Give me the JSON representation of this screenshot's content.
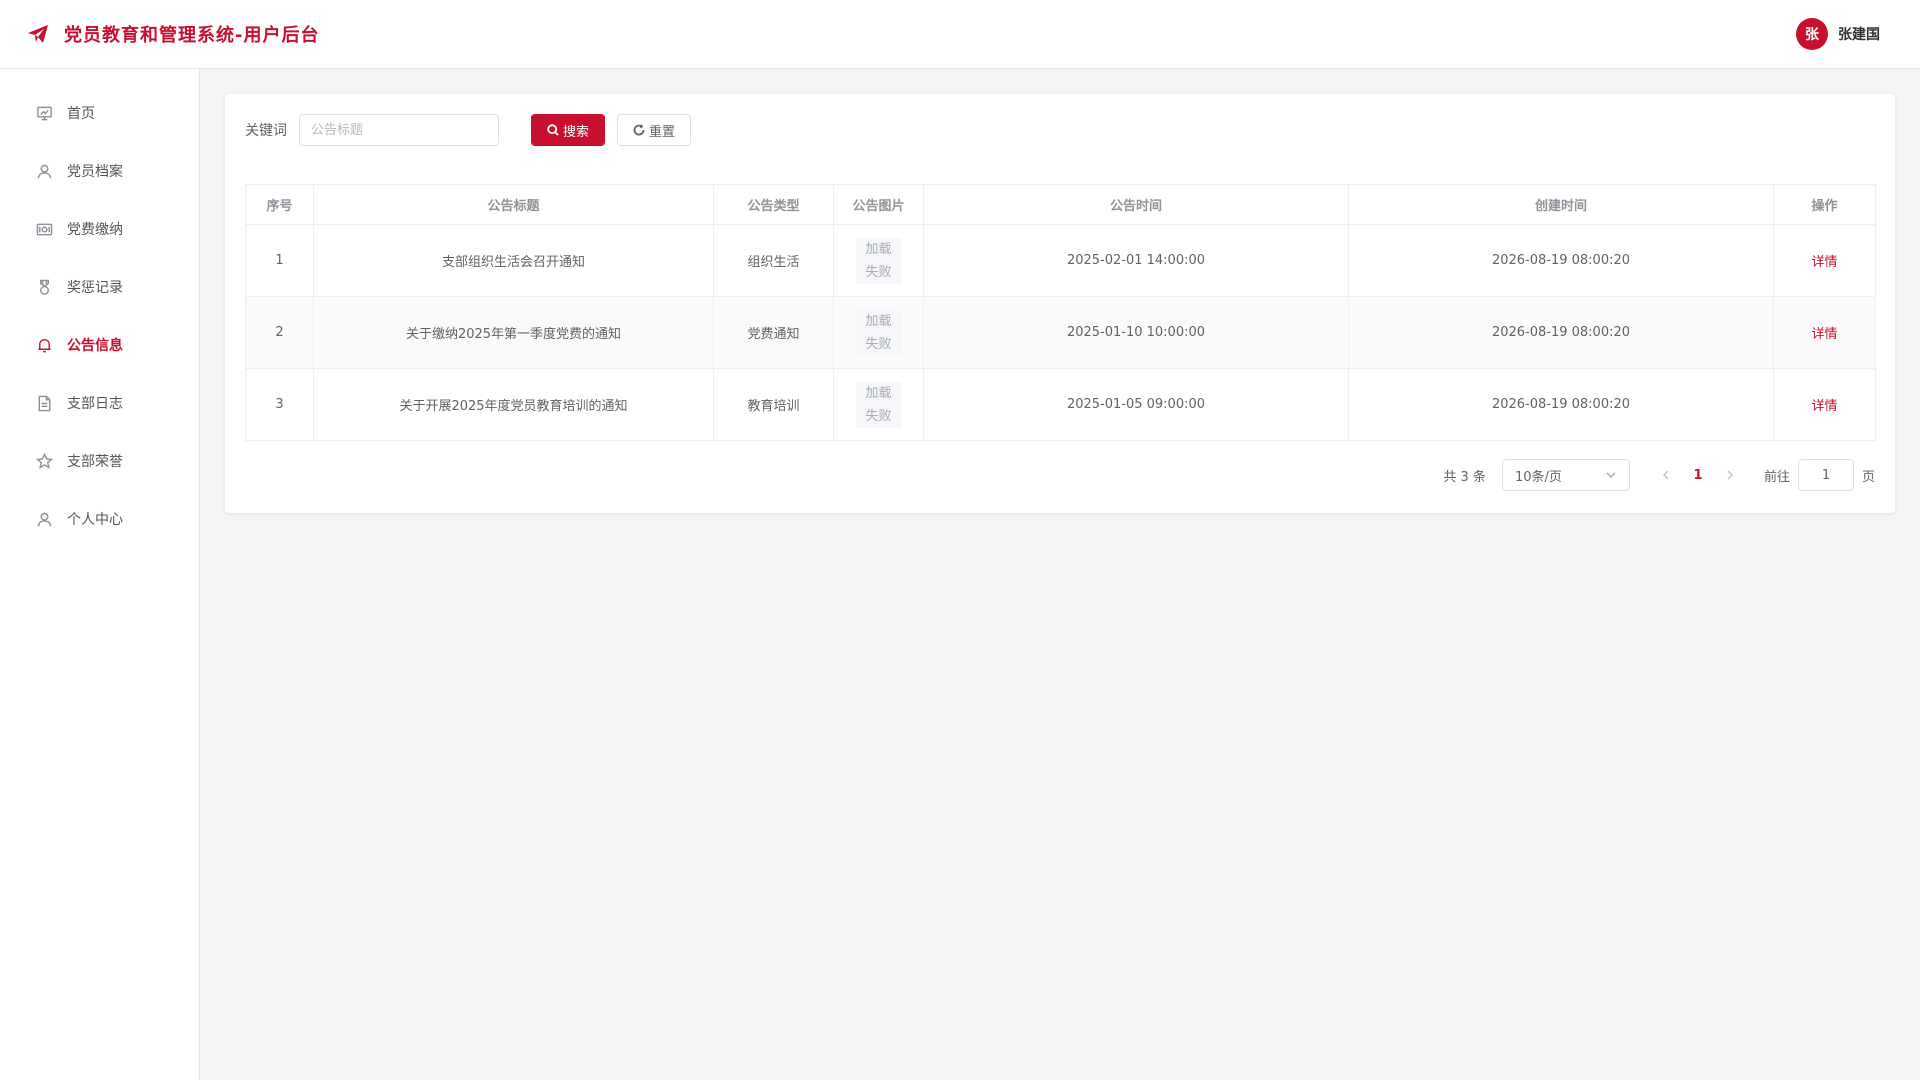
{
  "header": {
    "title": "党员教育和管理系统-用户后台",
    "user_initial": "张",
    "user_name": "张建国",
    "brand_color": "#c8102e"
  },
  "sidebar": {
    "items": [
      {
        "label": "首页",
        "icon": "presentation-icon",
        "active": false
      },
      {
        "label": "党员档案",
        "icon": "user-icon",
        "active": false
      },
      {
        "label": "党费缴纳",
        "icon": "money-icon",
        "active": false
      },
      {
        "label": "奖惩记录",
        "icon": "medal-icon",
        "active": false
      },
      {
        "label": "公告信息",
        "icon": "bell-icon",
        "active": true
      },
      {
        "label": "支部日志",
        "icon": "document-icon",
        "active": false
      },
      {
        "label": "支部荣誉",
        "icon": "star-icon",
        "active": false
      },
      {
        "label": "个人中心",
        "icon": "user-icon",
        "active": false
      }
    ]
  },
  "search": {
    "label": "关键词",
    "placeholder": "公告标题",
    "value": "",
    "search_button": "搜索",
    "reset_button": "重置"
  },
  "table": {
    "columns": [
      "序号",
      "公告标题",
      "公告类型",
      "公告图片",
      "公告时间",
      "创建时间",
      "操作"
    ],
    "rows": [
      {
        "index": "1",
        "title": "支部组织生活会召开通知",
        "type": "组织生活",
        "image": "加载失败",
        "time": "2025-02-01 14:00:00",
        "created": "2026-08-19 08:00:20",
        "action": "详情"
      },
      {
        "index": "2",
        "title": "关于缴纳2025年第一季度党费的通知",
        "type": "党费通知",
        "image": "加载失败",
        "time": "2025-01-10 10:00:00",
        "created": "2026-08-19 08:00:20",
        "action": "详情"
      },
      {
        "index": "3",
        "title": "关于开展2025年度党员教育培训的通知",
        "type": "教育培训",
        "image": "加载失败",
        "time": "2025-01-05 09:00:00",
        "created": "2026-08-19 08:00:20",
        "action": "详情"
      }
    ]
  },
  "pagination": {
    "total_text": "共 3 条",
    "page_size": "10条/页",
    "current_page": "1",
    "goto_label": "前往",
    "goto_value": "1",
    "page_unit": "页"
  }
}
